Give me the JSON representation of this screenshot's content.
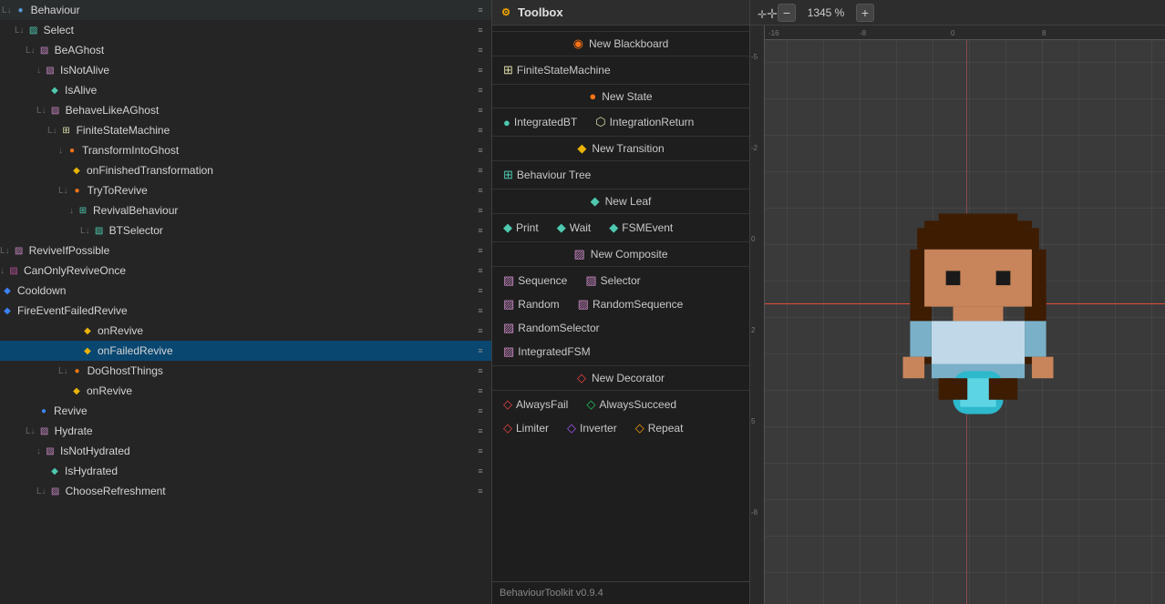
{
  "leftPanel": {
    "treeItems": [
      {
        "id": 0,
        "indent": 0,
        "icon": "expand",
        "iconColor": "#569cd6",
        "prefix": "L↓",
        "label": "Behaviour",
        "hasScroll": true
      },
      {
        "id": 1,
        "indent": 1,
        "icon": "selector",
        "iconColor": "#4ec9b0",
        "prefix": "L↓",
        "label": "Select",
        "hasScroll": true
      },
      {
        "id": 2,
        "indent": 2,
        "icon": "composite",
        "iconColor": "#c586c0",
        "prefix": "L↓",
        "label": "BeAGhost",
        "hasScroll": true
      },
      {
        "id": 3,
        "indent": 3,
        "icon": "decorator",
        "iconColor": "#c586c0",
        "prefix": "↓",
        "label": "IsNotAlive",
        "hasScroll": true
      },
      {
        "id": 4,
        "indent": 4,
        "icon": "leaf",
        "iconColor": "#4ec9b0",
        "prefix": "",
        "label": "IsAlive",
        "hasScroll": true
      },
      {
        "id": 5,
        "indent": 3,
        "icon": "composite",
        "iconColor": "#c586c0",
        "prefix": "L↓",
        "label": "BehaveLikeAGhost",
        "hasScroll": true
      },
      {
        "id": 6,
        "indent": 4,
        "icon": "fsm",
        "iconColor": "#dcdcaa",
        "prefix": "L↓",
        "label": "FiniteStateMachine",
        "hasScroll": true
      },
      {
        "id": 7,
        "indent": 5,
        "icon": "state",
        "iconColor": "#f97316",
        "prefix": "↓",
        "label": "TransformIntoGhost",
        "hasScroll": true
      },
      {
        "id": 8,
        "indent": 6,
        "icon": "transition",
        "iconColor": "#eab308",
        "prefix": "",
        "label": "onFinishedTransformation",
        "hasScroll": true
      },
      {
        "id": 9,
        "indent": 5,
        "icon": "state",
        "iconColor": "#f97316",
        "prefix": "L↓",
        "label": "TryToRevive",
        "hasScroll": true
      },
      {
        "id": 10,
        "indent": 6,
        "icon": "bt",
        "iconColor": "#4ec9b0",
        "prefix": "↓",
        "label": "RevivalBehaviour",
        "hasScroll": true
      },
      {
        "id": 11,
        "indent": 7,
        "icon": "selector",
        "iconColor": "#c586c0",
        "prefix": "L↓",
        "label": "BTSelector",
        "hasScroll": true
      },
      {
        "id": 12,
        "indent": 8,
        "icon": "composite",
        "iconColor": "#c586c0",
        "prefix": "L↓",
        "label": "ReviveIfPossible",
        "hasScroll": true
      },
      {
        "id": 13,
        "indent": 9,
        "icon": "decorator2",
        "iconColor": "#b05",
        "prefix": "↓",
        "label": "CanOnlyReviveOnce",
        "hasScroll": true
      },
      {
        "id": 14,
        "indent": 10,
        "icon": "leaf2",
        "iconColor": "#3b82f6",
        "prefix": "",
        "label": "Cooldown",
        "hasScroll": true
      },
      {
        "id": 15,
        "indent": 9,
        "icon": "leaf3",
        "iconColor": "#3b82f6",
        "prefix": "",
        "label": "FireEventFailedRevive",
        "hasScroll": true
      },
      {
        "id": 16,
        "indent": 7,
        "icon": "transition",
        "iconColor": "#eab308",
        "prefix": "",
        "label": "onRevive",
        "hasScroll": true
      },
      {
        "id": 17,
        "indent": 7,
        "icon": "transition",
        "iconColor": "#eab308",
        "prefix": "",
        "label": "onFailedRevive",
        "hasScroll": true,
        "selected": true
      },
      {
        "id": 18,
        "indent": 5,
        "icon": "state",
        "iconColor": "#f97316",
        "prefix": "L↓",
        "label": "DoGhostThings",
        "hasScroll": true
      },
      {
        "id": 19,
        "indent": 6,
        "icon": "transition",
        "iconColor": "#eab308",
        "prefix": "",
        "label": "onRevive",
        "hasScroll": true
      },
      {
        "id": 20,
        "indent": 3,
        "icon": "revive",
        "iconColor": "#3b82f6",
        "prefix": "",
        "label": "Revive",
        "hasScroll": true
      },
      {
        "id": 21,
        "indent": 2,
        "icon": "composite",
        "iconColor": "#c586c0",
        "prefix": "L↓",
        "label": "Hydrate",
        "hasScroll": true
      },
      {
        "id": 22,
        "indent": 3,
        "icon": "decorator",
        "iconColor": "#c586c0",
        "prefix": "↓",
        "label": "IsNotHydrated",
        "hasScroll": true
      },
      {
        "id": 23,
        "indent": 4,
        "icon": "leaf",
        "iconColor": "#4ec9b0",
        "prefix": "",
        "label": "IsHydrated",
        "hasScroll": true
      },
      {
        "id": 24,
        "indent": 3,
        "icon": "composite",
        "iconColor": "#c586c0",
        "prefix": "L↓",
        "label": "ChooseRefreshment",
        "hasScroll": true
      }
    ]
  },
  "toolbox": {
    "title": "Toolbox",
    "sections": [
      {
        "type": "header",
        "icon": "blackboard",
        "label": "New Blackboard"
      },
      {
        "type": "items",
        "items": [
          {
            "icon": "fsm",
            "label": "FiniteStateMachine"
          }
        ]
      },
      {
        "type": "header",
        "icon": "state",
        "label": "New State"
      },
      {
        "type": "items",
        "items": [
          {
            "icon": "integratedbt",
            "label": "IntegratedBT"
          },
          {
            "icon": "integrationreturn",
            "label": "IntegrationReturn"
          }
        ]
      },
      {
        "type": "header",
        "icon": "transition",
        "label": "New Transition"
      },
      {
        "type": "items",
        "items": [
          {
            "icon": "bt",
            "label": "Behaviour Tree"
          }
        ]
      },
      {
        "type": "header",
        "icon": "leaf",
        "label": "New Leaf"
      },
      {
        "type": "items",
        "items": [
          {
            "icon": "print",
            "label": "Print"
          },
          {
            "icon": "wait",
            "label": "Wait"
          },
          {
            "icon": "fsmevent",
            "label": "FSMEvent"
          }
        ]
      },
      {
        "type": "header",
        "icon": "composite",
        "label": "New Composite"
      },
      {
        "type": "items",
        "items": [
          {
            "icon": "sequence",
            "label": "Sequence"
          },
          {
            "icon": "selector",
            "label": "Selector"
          }
        ]
      },
      {
        "type": "items",
        "items": [
          {
            "icon": "random",
            "label": "Random"
          },
          {
            "icon": "randomsequence",
            "label": "RandomSequence"
          }
        ]
      },
      {
        "type": "items",
        "items": [
          {
            "icon": "randomselector",
            "label": "RandomSelector"
          }
        ]
      },
      {
        "type": "items",
        "items": [
          {
            "icon": "integratedfsm",
            "label": "IntegratedFSM"
          }
        ]
      },
      {
        "type": "header",
        "icon": "decorator",
        "label": "New Decorator"
      },
      {
        "type": "items",
        "items": [
          {
            "icon": "alwaysfail",
            "label": "AlwaysFail"
          },
          {
            "icon": "alwayssucceed",
            "label": "AlwaysSucceed"
          }
        ]
      },
      {
        "type": "items",
        "items": [
          {
            "icon": "limiter",
            "label": "Limiter"
          },
          {
            "icon": "inverter",
            "label": "Inverter"
          },
          {
            "icon": "repeat",
            "label": "Repeat"
          }
        ]
      }
    ],
    "footer": "BehaviourToolkit v0.9.4",
    "version": "BehaviourToolkit v0.9.4"
  },
  "canvas": {
    "zoomLevel": "1345 %",
    "zoomMinus": "−",
    "zoomPlus": "+",
    "moveIcon": "✛"
  }
}
